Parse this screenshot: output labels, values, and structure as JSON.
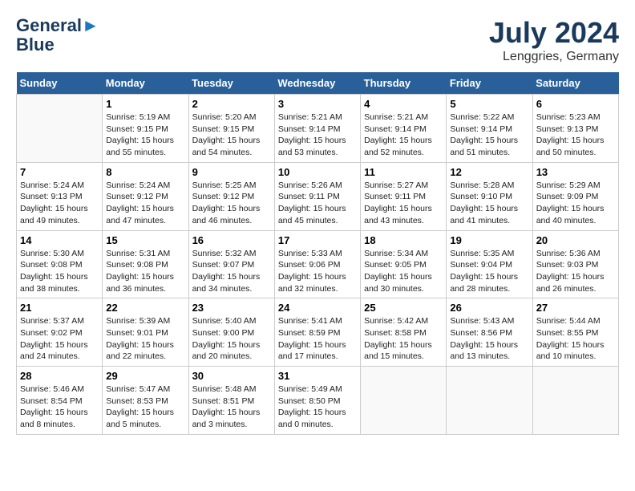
{
  "header": {
    "logo_line1": "General",
    "logo_line2": "Blue",
    "month_year": "July 2024",
    "location": "Lenggries, Germany"
  },
  "columns": [
    "Sunday",
    "Monday",
    "Tuesday",
    "Wednesday",
    "Thursday",
    "Friday",
    "Saturday"
  ],
  "weeks": [
    [
      {
        "day": "",
        "info": ""
      },
      {
        "day": "1",
        "info": "Sunrise: 5:19 AM\nSunset: 9:15 PM\nDaylight: 15 hours\nand 55 minutes."
      },
      {
        "day": "2",
        "info": "Sunrise: 5:20 AM\nSunset: 9:15 PM\nDaylight: 15 hours\nand 54 minutes."
      },
      {
        "day": "3",
        "info": "Sunrise: 5:21 AM\nSunset: 9:14 PM\nDaylight: 15 hours\nand 53 minutes."
      },
      {
        "day": "4",
        "info": "Sunrise: 5:21 AM\nSunset: 9:14 PM\nDaylight: 15 hours\nand 52 minutes."
      },
      {
        "day": "5",
        "info": "Sunrise: 5:22 AM\nSunset: 9:14 PM\nDaylight: 15 hours\nand 51 minutes."
      },
      {
        "day": "6",
        "info": "Sunrise: 5:23 AM\nSunset: 9:13 PM\nDaylight: 15 hours\nand 50 minutes."
      }
    ],
    [
      {
        "day": "7",
        "info": "Sunrise: 5:24 AM\nSunset: 9:13 PM\nDaylight: 15 hours\nand 49 minutes."
      },
      {
        "day": "8",
        "info": "Sunrise: 5:24 AM\nSunset: 9:12 PM\nDaylight: 15 hours\nand 47 minutes."
      },
      {
        "day": "9",
        "info": "Sunrise: 5:25 AM\nSunset: 9:12 PM\nDaylight: 15 hours\nand 46 minutes."
      },
      {
        "day": "10",
        "info": "Sunrise: 5:26 AM\nSunset: 9:11 PM\nDaylight: 15 hours\nand 45 minutes."
      },
      {
        "day": "11",
        "info": "Sunrise: 5:27 AM\nSunset: 9:11 PM\nDaylight: 15 hours\nand 43 minutes."
      },
      {
        "day": "12",
        "info": "Sunrise: 5:28 AM\nSunset: 9:10 PM\nDaylight: 15 hours\nand 41 minutes."
      },
      {
        "day": "13",
        "info": "Sunrise: 5:29 AM\nSunset: 9:09 PM\nDaylight: 15 hours\nand 40 minutes."
      }
    ],
    [
      {
        "day": "14",
        "info": "Sunrise: 5:30 AM\nSunset: 9:08 PM\nDaylight: 15 hours\nand 38 minutes."
      },
      {
        "day": "15",
        "info": "Sunrise: 5:31 AM\nSunset: 9:08 PM\nDaylight: 15 hours\nand 36 minutes."
      },
      {
        "day": "16",
        "info": "Sunrise: 5:32 AM\nSunset: 9:07 PM\nDaylight: 15 hours\nand 34 minutes."
      },
      {
        "day": "17",
        "info": "Sunrise: 5:33 AM\nSunset: 9:06 PM\nDaylight: 15 hours\nand 32 minutes."
      },
      {
        "day": "18",
        "info": "Sunrise: 5:34 AM\nSunset: 9:05 PM\nDaylight: 15 hours\nand 30 minutes."
      },
      {
        "day": "19",
        "info": "Sunrise: 5:35 AM\nSunset: 9:04 PM\nDaylight: 15 hours\nand 28 minutes."
      },
      {
        "day": "20",
        "info": "Sunrise: 5:36 AM\nSunset: 9:03 PM\nDaylight: 15 hours\nand 26 minutes."
      }
    ],
    [
      {
        "day": "21",
        "info": "Sunrise: 5:37 AM\nSunset: 9:02 PM\nDaylight: 15 hours\nand 24 minutes."
      },
      {
        "day": "22",
        "info": "Sunrise: 5:39 AM\nSunset: 9:01 PM\nDaylight: 15 hours\nand 22 minutes."
      },
      {
        "day": "23",
        "info": "Sunrise: 5:40 AM\nSunset: 9:00 PM\nDaylight: 15 hours\nand 20 minutes."
      },
      {
        "day": "24",
        "info": "Sunrise: 5:41 AM\nSunset: 8:59 PM\nDaylight: 15 hours\nand 17 minutes."
      },
      {
        "day": "25",
        "info": "Sunrise: 5:42 AM\nSunset: 8:58 PM\nDaylight: 15 hours\nand 15 minutes."
      },
      {
        "day": "26",
        "info": "Sunrise: 5:43 AM\nSunset: 8:56 PM\nDaylight: 15 hours\nand 13 minutes."
      },
      {
        "day": "27",
        "info": "Sunrise: 5:44 AM\nSunset: 8:55 PM\nDaylight: 15 hours\nand 10 minutes."
      }
    ],
    [
      {
        "day": "28",
        "info": "Sunrise: 5:46 AM\nSunset: 8:54 PM\nDaylight: 15 hours\nand 8 minutes."
      },
      {
        "day": "29",
        "info": "Sunrise: 5:47 AM\nSunset: 8:53 PM\nDaylight: 15 hours\nand 5 minutes."
      },
      {
        "day": "30",
        "info": "Sunrise: 5:48 AM\nSunset: 8:51 PM\nDaylight: 15 hours\nand 3 minutes."
      },
      {
        "day": "31",
        "info": "Sunrise: 5:49 AM\nSunset: 8:50 PM\nDaylight: 15 hours\nand 0 minutes."
      },
      {
        "day": "",
        "info": ""
      },
      {
        "day": "",
        "info": ""
      },
      {
        "day": "",
        "info": ""
      }
    ]
  ]
}
